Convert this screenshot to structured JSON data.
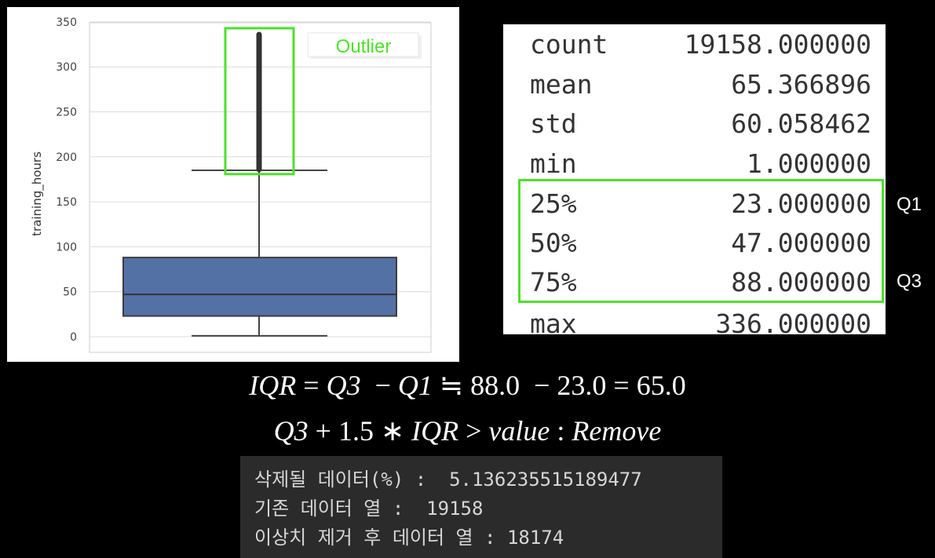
{
  "boxplot": {
    "ylabel": "training_hours",
    "yticks": [
      0,
      50,
      100,
      150,
      200,
      250,
      300,
      350
    ],
    "ylim": [
      -15,
      350
    ],
    "box": {
      "q1": 23,
      "median": 47,
      "q3": 88,
      "whisker_low": 1,
      "whisker_high": 185
    },
    "outlier_range": [
      186,
      336
    ],
    "annotation": "Outlier",
    "colors": {
      "box": "#5471a6",
      "highlight": "#4de12a"
    }
  },
  "stats": {
    "rows": [
      {
        "name": "count",
        "value": "19158.000000"
      },
      {
        "name": "mean",
        "value": "65.366896"
      },
      {
        "name": "std",
        "value": "60.058462"
      },
      {
        "name": "min",
        "value": "1.000000"
      },
      {
        "name": "25%",
        "value": "23.000000"
      },
      {
        "name": "50%",
        "value": "47.000000"
      },
      {
        "name": "75%",
        "value": "88.000000"
      },
      {
        "name": "max",
        "value": "336.000000"
      }
    ],
    "q1_label": "Q1",
    "q3_label": "Q3"
  },
  "formulas": {
    "line1": {
      "iqr": "IQR",
      "eq1": " = ",
      "q3": "Q3",
      "minus1": "  − ",
      "q1": "Q1",
      "approx": " ≒ 88.0  − 23.0 = 65.0"
    },
    "line2": {
      "q3": "Q3",
      "plus": " + 1.5 ∗ ",
      "iqr": "IQR",
      "gt": " > ",
      "value": "value",
      "colon": " : ",
      "remove": "Remove"
    }
  },
  "console": {
    "line1": "삭제될 데이터(%) :  5.136235515189477",
    "line2": "기존 데이터 열 :  19158",
    "line3": "이상치 제거 후 데이터 열 : 18174"
  }
}
